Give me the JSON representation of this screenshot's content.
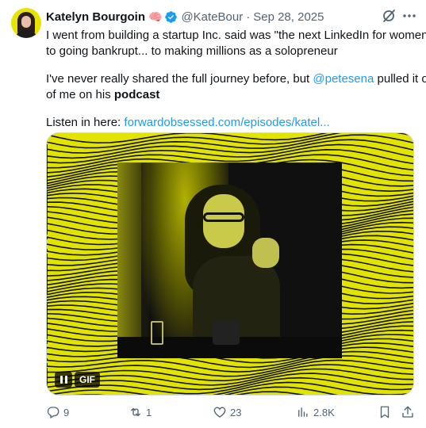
{
  "author": {
    "name": "Katelyn Bourgoin",
    "emoji": "🧠",
    "handle": "@KateBour",
    "separator": "·",
    "date": "Sep 28, 2025"
  },
  "body": {
    "line1": "I went from building a startup Inc. said was \"the next LinkedIn for women\"...",
    "line2": "to going bankrupt... to making millions as a solopreneur",
    "line3": "I've never really shared the full journey before, but ",
    "mention": "@petesena",
    "line3b": " pulled it out",
    "line4a": "of me on his ",
    "line4b": "podcast",
    "listen_prefix": "Listen in here: ",
    "link": "forwardobsessed.com/episodes/katel..."
  },
  "media": {
    "badge": "GIF"
  },
  "actions": {
    "replies": "9",
    "reposts": "1",
    "likes": "23",
    "views": "2.8K"
  },
  "colors": {
    "accent": "#1d9bf0",
    "media_bg": "#e2e400",
    "muted": "#536471"
  }
}
